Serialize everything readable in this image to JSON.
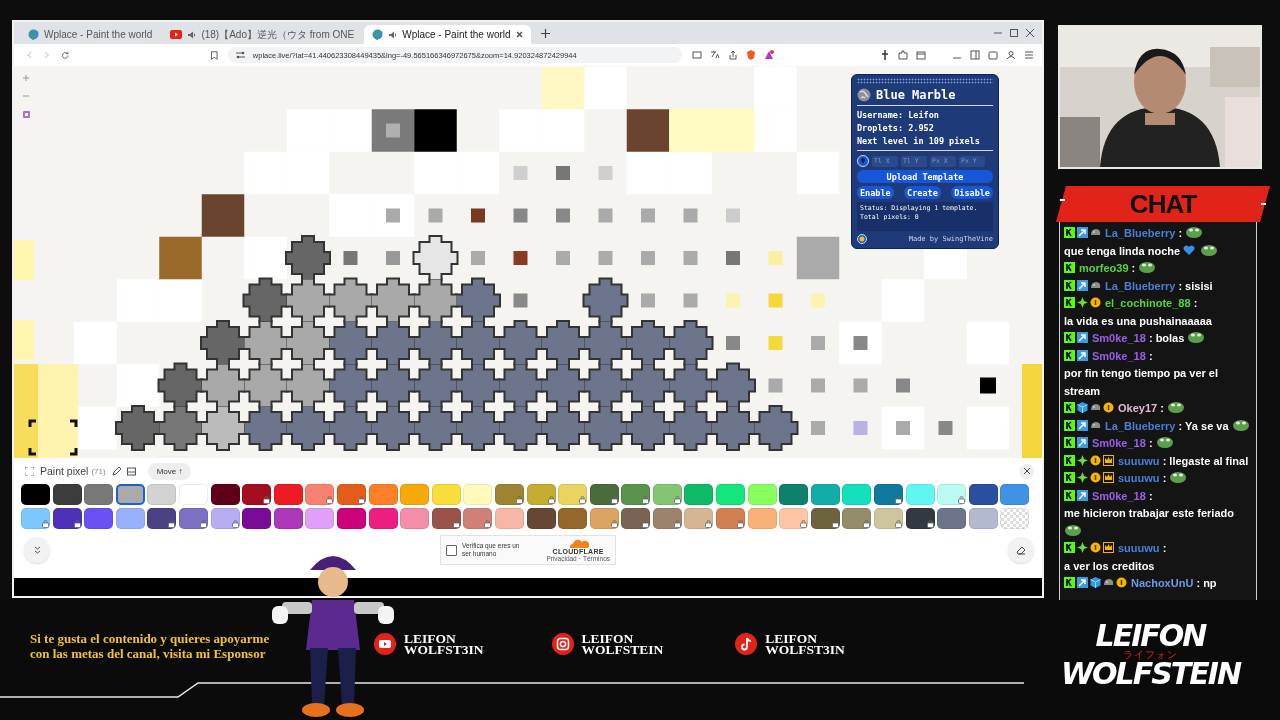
{
  "browser": {
    "tabs": [
      {
        "title": "Wplace - Paint the world",
        "kind": "globe",
        "audio": false,
        "selected": false
      },
      {
        "title": "(18)【Ado】逆光（ウタ from ONE",
        "kind": "video",
        "audio": true,
        "selected": false
      },
      {
        "title": "Wplace - Paint the world",
        "kind": "globe",
        "audio": true,
        "selected": true
      }
    ],
    "url": "wplace.live/?lat=41.440623308449435&lng=-49.565166346972675&zoom=14.920324872429944"
  },
  "blue_marble": {
    "title": "Blue Marble",
    "stats": [
      "Username: Leifon",
      "Droplets: 2.952",
      "Next level in 109 pixels"
    ],
    "coord_fields": [
      {
        "placeholder": "Tl X"
      },
      {
        "placeholder": "Tl Y"
      },
      {
        "placeholder": "Px X"
      },
      {
        "placeholder": "Px Y"
      }
    ],
    "upload_button": "Upload Template",
    "buttons": [
      "Enable",
      "Create",
      "Disable"
    ],
    "status": "Status: Displaying 1 template.\nTotal pixels: 0",
    "credit": "Made by SwingTheVine"
  },
  "paint_panel": {
    "title": "Paint pixel",
    "count": "(71)",
    "move_button": "Move ↑",
    "palette": [
      {
        "kind": "solid",
        "color": "#000000",
        "locked": false,
        "selected": false
      },
      {
        "kind": "solid",
        "color": "#3c3c3c",
        "locked": false,
        "selected": false
      },
      {
        "kind": "solid",
        "color": "#787878",
        "locked": false,
        "selected": false
      },
      {
        "kind": "solid",
        "color": "#aaaaaa",
        "locked": false,
        "selected": true
      },
      {
        "kind": "solid",
        "color": "#d2d2d2",
        "locked": false,
        "selected": false
      },
      {
        "kind": "solid",
        "color": "#ffffff",
        "locked": false,
        "selected": false
      },
      {
        "kind": "solid",
        "color": "#600018",
        "locked": false,
        "selected": false
      },
      {
        "kind": "solid",
        "color": "#a50e1e",
        "locked": true,
        "selected": false
      },
      {
        "kind": "solid",
        "color": "#ed1c24",
        "locked": false,
        "selected": false
      },
      {
        "kind": "solid",
        "color": "#fa8072",
        "locked": true,
        "selected": false
      },
      {
        "kind": "solid",
        "color": "#e45c1a",
        "locked": true,
        "selected": false
      },
      {
        "kind": "solid",
        "color": "#ff7f27",
        "locked": false,
        "selected": false
      },
      {
        "kind": "solid",
        "color": "#f6aa09",
        "locked": false,
        "selected": false
      },
      {
        "kind": "solid",
        "color": "#f9dd3b",
        "locked": false,
        "selected": false
      },
      {
        "kind": "solid",
        "color": "#fffabc",
        "locked": false,
        "selected": false
      },
      {
        "kind": "solid",
        "color": "#9c8431",
        "locked": true,
        "selected": false
      },
      {
        "kind": "solid",
        "color": "#c5ad31",
        "locked": true,
        "selected": false
      },
      {
        "kind": "solid",
        "color": "#e8d45f",
        "locked": true,
        "selected": false
      },
      {
        "kind": "solid",
        "color": "#4a6b3a",
        "locked": true,
        "selected": false
      },
      {
        "kind": "solid",
        "color": "#5a944a",
        "locked": true,
        "selected": false
      },
      {
        "kind": "solid",
        "color": "#84c573",
        "locked": true,
        "selected": false
      },
      {
        "kind": "solid",
        "color": "#0eb968",
        "locked": false,
        "selected": false
      },
      {
        "kind": "solid",
        "color": "#13e67b",
        "locked": false,
        "selected": false
      },
      {
        "kind": "solid",
        "color": "#87ff5e",
        "locked": false,
        "selected": false
      },
      {
        "kind": "solid",
        "color": "#0c816e",
        "locked": false,
        "selected": false
      },
      {
        "kind": "solid",
        "color": "#10aea6",
        "locked": false,
        "selected": false
      },
      {
        "kind": "solid",
        "color": "#13e1be",
        "locked": false,
        "selected": false
      },
      {
        "kind": "solid",
        "color": "#0f799f",
        "locked": true,
        "selected": false
      },
      {
        "kind": "solid",
        "color": "#60f7f2",
        "locked": false,
        "selected": false
      },
      {
        "kind": "solid",
        "color": "#bbfaf2",
        "locked": true,
        "selected": false
      },
      {
        "kind": "solid",
        "color": "#28509e",
        "locked": false,
        "selected": false
      },
      {
        "kind": "solid",
        "color": "#4093e4",
        "locked": false,
        "selected": false
      },
      {
        "kind": "solid",
        "color": "#7dc7ff",
        "locked": true,
        "selected": false
      },
      {
        "kind": "solid",
        "color": "#4d31b8",
        "locked": true,
        "selected": false
      },
      {
        "kind": "solid",
        "color": "#6b50f6",
        "locked": false,
        "selected": false
      },
      {
        "kind": "solid",
        "color": "#99b1fb",
        "locked": false,
        "selected": false
      },
      {
        "kind": "solid",
        "color": "#4a4284",
        "locked": true,
        "selected": false
      },
      {
        "kind": "solid",
        "color": "#7a71c4",
        "locked": true,
        "selected": false
      },
      {
        "kind": "solid",
        "color": "#b5aef1",
        "locked": true,
        "selected": false
      },
      {
        "kind": "solid",
        "color": "#780c99",
        "locked": false,
        "selected": false
      },
      {
        "kind": "solid",
        "color": "#aa38b9",
        "locked": false,
        "selected": false
      },
      {
        "kind": "solid",
        "color": "#e09ff9",
        "locked": false,
        "selected": false
      },
      {
        "kind": "solid",
        "color": "#cb007a",
        "locked": false,
        "selected": false
      },
      {
        "kind": "solid",
        "color": "#ec1f80",
        "locked": false,
        "selected": false
      },
      {
        "kind": "solid",
        "color": "#f38da9",
        "locked": false,
        "selected": false
      },
      {
        "kind": "solid",
        "color": "#9b5249",
        "locked": true,
        "selected": false
      },
      {
        "kind": "solid",
        "color": "#d18078",
        "locked": true,
        "selected": false
      },
      {
        "kind": "solid",
        "color": "#fab6a4",
        "locked": false,
        "selected": false
      },
      {
        "kind": "solid",
        "color": "#684634",
        "locked": false,
        "selected": false
      },
      {
        "kind": "solid",
        "color": "#95682a",
        "locked": false,
        "selected": false
      },
      {
        "kind": "solid",
        "color": "#dba463",
        "locked": true,
        "selected": false
      },
      {
        "kind": "solid",
        "color": "#7b6352",
        "locked": true,
        "selected": false
      },
      {
        "kind": "solid",
        "color": "#9c846b",
        "locked": true,
        "selected": false
      },
      {
        "kind": "solid",
        "color": "#d6b594",
        "locked": true,
        "selected": false
      },
      {
        "kind": "solid",
        "color": "#d18051",
        "locked": true,
        "selected": false
      },
      {
        "kind": "solid",
        "color": "#f8b277",
        "locked": false,
        "selected": false
      },
      {
        "kind": "solid",
        "color": "#ffc5a5",
        "locked": true,
        "selected": false
      },
      {
        "kind": "solid",
        "color": "#6d643f",
        "locked": true,
        "selected": false
      },
      {
        "kind": "solid",
        "color": "#948c6b",
        "locked": true,
        "selected": false
      },
      {
        "kind": "solid",
        "color": "#cdc59e",
        "locked": true,
        "selected": false
      },
      {
        "kind": "solid",
        "color": "#333941",
        "locked": true,
        "selected": false
      },
      {
        "kind": "solid",
        "color": "#6d758d",
        "locked": false,
        "selected": false
      },
      {
        "kind": "solid",
        "color": "#b3b9d1",
        "locked": false,
        "selected": false
      },
      {
        "kind": "transparent",
        "locked": false,
        "selected": false
      }
    ]
  },
  "captcha": {
    "checked": false,
    "label": "Verifica que eres un ser humano",
    "brand": "CLOUDFLARE",
    "links": [
      "Privacidad",
      "Términos"
    ],
    "links_separator": "·"
  },
  "chat": {
    "title": "CHAT",
    "messages": [
      {
        "user": "La_Blueberry",
        "color": "#4a7fd6",
        "badges": [
          {
            "kind": "kick"
          },
          {
            "kind": "arrow"
          },
          {
            "kind": "grey"
          }
        ],
        "separator": ":",
        "parts": [
          {
            "kind": "emote"
          },
          {
            "kind": "text",
            "text": "que tenga linda noche"
          },
          {
            "kind": "heart"
          },
          {
            "kind": "emote"
          }
        ]
      },
      {
        "user": "morfeo39",
        "color": "#52d63d",
        "badges": [
          {
            "kind": "kick"
          }
        ],
        "separator": ":",
        "parts": [
          {
            "kind": "emote"
          }
        ]
      },
      {
        "user": "La_Blueberry",
        "color": "#4a7fd6",
        "badges": [
          {
            "kind": "kick"
          },
          {
            "kind": "arrow"
          },
          {
            "kind": "grey"
          }
        ],
        "separator": ":",
        "parts": [
          {
            "kind": "text",
            "text": "sisisi"
          }
        ]
      },
      {
        "user": "el_cochinote_88",
        "color": "#52d63d",
        "badges": [
          {
            "kind": "kick"
          },
          {
            "kind": "diamond"
          },
          {
            "kind": "coin"
          }
        ],
        "separator": ":",
        "parts": [
          {
            "kind": "text",
            "text": "la vida es una pushainaaaaa"
          }
        ]
      },
      {
        "user": "Sm0ke_18",
        "color": "#9b5ee6",
        "badges": [
          {
            "kind": "kick"
          },
          {
            "kind": "arrow"
          }
        ],
        "separator": ":",
        "parts": [
          {
            "kind": "text",
            "text": "bolas"
          },
          {
            "kind": "emote"
          }
        ]
      },
      {
        "user": "Sm0ke_18",
        "color": "#9b5ee6",
        "badges": [
          {
            "kind": "kick"
          },
          {
            "kind": "arrow"
          }
        ],
        "separator": ":",
        "parts": [
          {
            "kind": "text",
            "text": "por fin tengo tiempo pa ver el stream"
          }
        ]
      },
      {
        "user": "Okey17",
        "color": "#e6b8d8",
        "badges": [
          {
            "kind": "kick"
          },
          {
            "kind": "cube"
          },
          {
            "kind": "grey"
          },
          {
            "kind": "coin"
          }
        ],
        "separator": ":",
        "parts": [
          {
            "kind": "emote"
          }
        ]
      },
      {
        "user": "La_Blueberry",
        "color": "#4a7fd6",
        "badges": [
          {
            "kind": "kick"
          },
          {
            "kind": "arrow"
          },
          {
            "kind": "grey"
          }
        ],
        "separator": ":",
        "parts": [
          {
            "kind": "text",
            "text": "Ya se va"
          },
          {
            "kind": "emote"
          }
        ]
      },
      {
        "user": "Sm0ke_18",
        "color": "#9b5ee6",
        "badges": [
          {
            "kind": "kick"
          },
          {
            "kind": "arrow"
          }
        ],
        "separator": ":",
        "parts": [
          {
            "kind": "emote"
          }
        ]
      },
      {
        "user": "suuuwu",
        "color": "#4a7fd6",
        "badges": [
          {
            "kind": "kick"
          },
          {
            "kind": "diamond"
          },
          {
            "kind": "coin"
          },
          {
            "kind": "crown"
          }
        ],
        "separator": ":",
        "parts": [
          {
            "kind": "text",
            "text": "llegaste al final"
          }
        ]
      },
      {
        "user": "suuuwu",
        "color": "#4a7fd6",
        "badges": [
          {
            "kind": "kick"
          },
          {
            "kind": "diamond"
          },
          {
            "kind": "coin"
          },
          {
            "kind": "crown"
          }
        ],
        "separator": ":",
        "parts": [
          {
            "kind": "emote"
          }
        ]
      },
      {
        "user": "Sm0ke_18",
        "color": "#9b5ee6",
        "badges": [
          {
            "kind": "kick"
          },
          {
            "kind": "arrow"
          }
        ],
        "separator": ":",
        "parts": [
          {
            "kind": "text",
            "text": "me hicieron trabajar este feriado"
          },
          {
            "kind": "emote"
          }
        ]
      },
      {
        "user": "suuuwu",
        "color": "#4a7fd6",
        "badges": [
          {
            "kind": "kick"
          },
          {
            "kind": "diamond"
          },
          {
            "kind": "coin"
          },
          {
            "kind": "crown"
          }
        ],
        "separator": ":",
        "parts": [
          {
            "kind": "text",
            "text": "a ver los creditos"
          }
        ]
      },
      {
        "user": "NachoxUnU",
        "color": "#6d9be8",
        "badges": [
          {
            "kind": "kick"
          },
          {
            "kind": "arrow"
          },
          {
            "kind": "cube"
          },
          {
            "kind": "grey"
          },
          {
            "kind": "coin"
          }
        ],
        "separator": ":",
        "parts": [
          {
            "kind": "text",
            "text": "np"
          }
        ]
      }
    ]
  },
  "footer": {
    "promo": "Si te gusta el contenido y quieres apoyarme con las metas del canal, visita mi Esponsor",
    "socials": [
      {
        "kind": "youtube",
        "handle": "LEIFON WOLFST3IN"
      },
      {
        "kind": "instagram",
        "handle": "LEIFON WOLFSTEIN"
      },
      {
        "kind": "tiktok",
        "handle": "LEIFON WOLFST3IN"
      }
    ],
    "logo": {
      "line_1": "LEIFON",
      "subtitle": "ライフォン",
      "line_2": "WOLFSTEIN"
    }
  }
}
